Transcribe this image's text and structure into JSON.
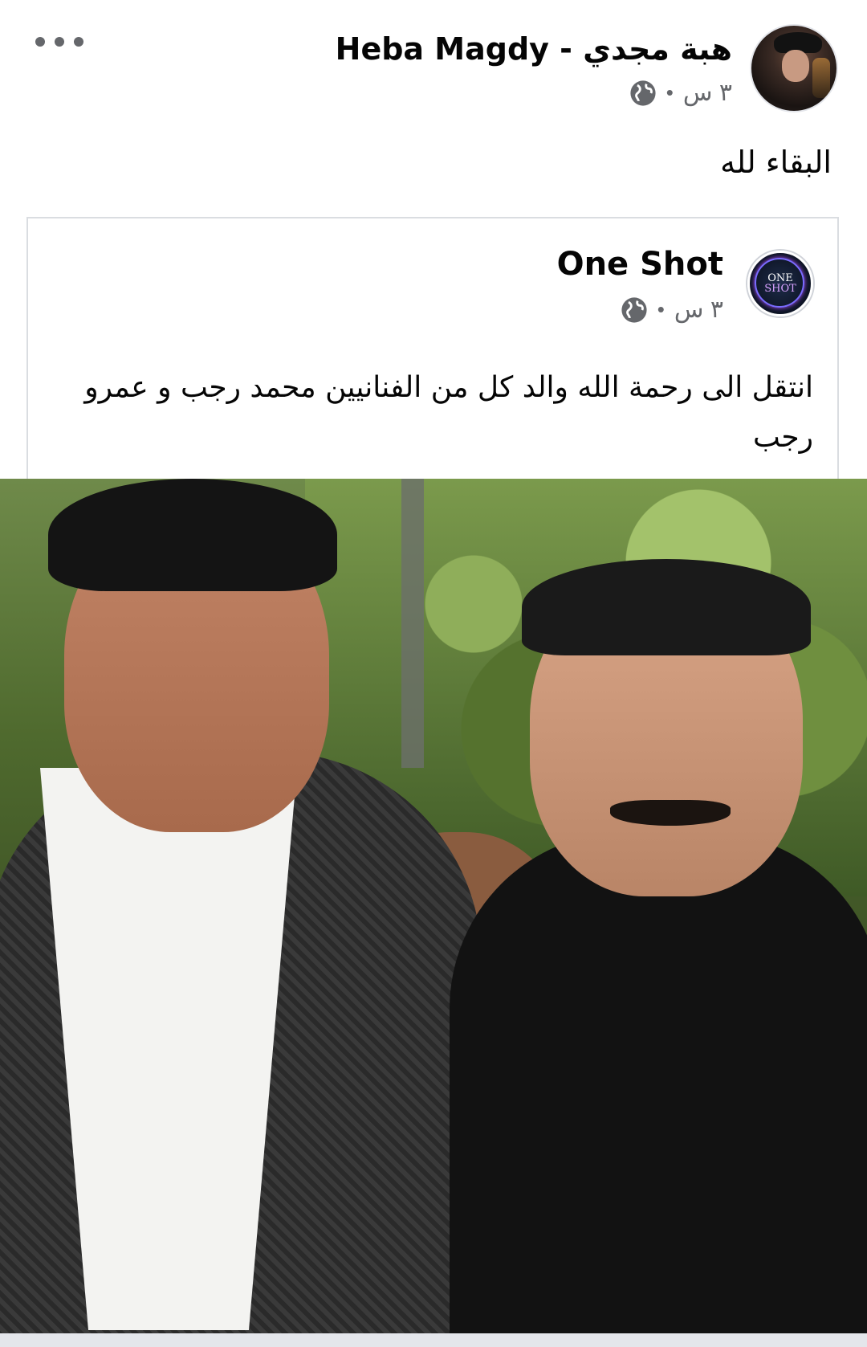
{
  "post": {
    "author": "Heba Magdy - هبة مجدي",
    "time": "٣ س",
    "separator": "•",
    "privacy_icon": "globe-icon",
    "text": "البقاء لله",
    "more_icon": "more-horizontal-icon"
  },
  "shared": {
    "page_name": "One Shot",
    "page_logo": {
      "line1": "ONE",
      "line2": "SHOT"
    },
    "time": "٣ س",
    "separator": "•",
    "privacy_icon": "globe-icon",
    "text": "انتقل الى رحمة الله والد كل من الفنانيين محمد رجب و عمرو رجب"
  },
  "colors": {
    "meta_gray": "#65676b",
    "border": "#dadde1",
    "text": "#050505"
  }
}
